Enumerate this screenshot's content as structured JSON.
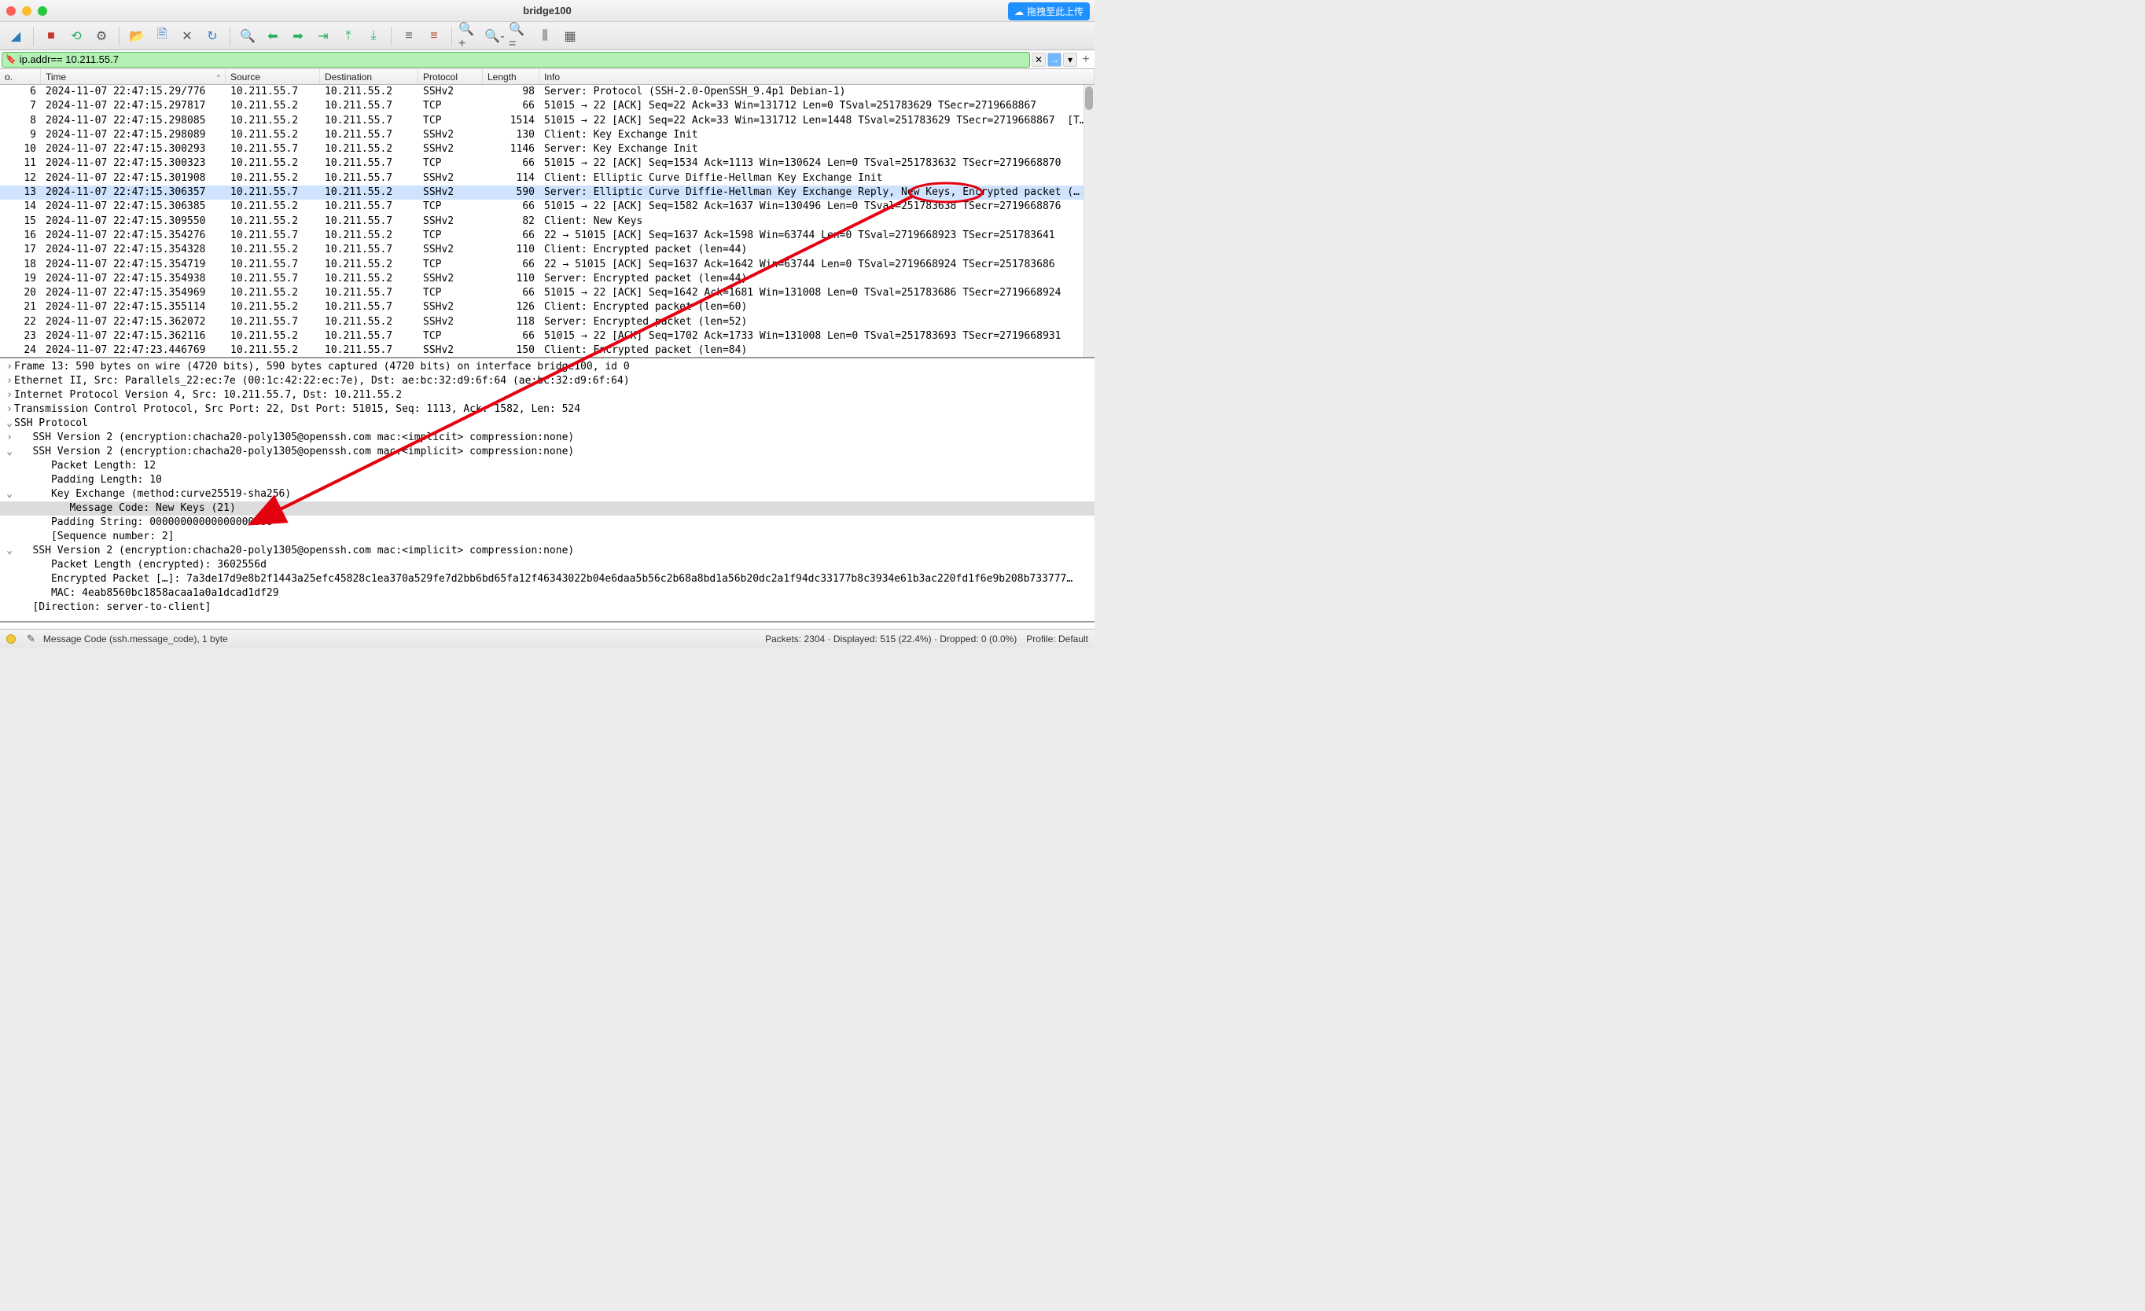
{
  "window": {
    "title": "bridge100"
  },
  "upload": {
    "label": "拖拽至此上传"
  },
  "toolbar": {
    "icons": [
      "shark-fin",
      "stop-capture",
      "restart-capture",
      "options",
      "open-folder",
      "save",
      "close-file",
      "reload",
      "find",
      "go-back",
      "go-forward",
      "jump-target",
      "go-first",
      "go-last",
      "auto-scroll",
      "colorize",
      "zoom-in",
      "zoom-out",
      "zoom-reset",
      "resize-columns",
      "resize-all"
    ]
  },
  "filter": {
    "text": "ip.addr== 10.211.55.7"
  },
  "columns": {
    "no": "o.",
    "time": "Time",
    "source": "Source",
    "destination": "Destination",
    "protocol": "Protocol",
    "length": "Length",
    "info": "Info"
  },
  "packets": [
    {
      "no": 6,
      "time": "2024-11-07 22:47:15.29/776",
      "src": "10.211.55.7",
      "dst": "10.211.55.2",
      "proto": "SSHv2",
      "len": 98,
      "info": "Server: Protocol (SSH-2.0-OpenSSH_9.4p1 Debian-1)"
    },
    {
      "no": 7,
      "time": "2024-11-07 22:47:15.297817",
      "src": "10.211.55.2",
      "dst": "10.211.55.7",
      "proto": "TCP",
      "len": 66,
      "info": "51015 → 22 [ACK] Seq=22 Ack=33 Win=131712 Len=0 TSval=251783629 TSecr=2719668867"
    },
    {
      "no": 8,
      "time": "2024-11-07 22:47:15.298085",
      "src": "10.211.55.2",
      "dst": "10.211.55.7",
      "proto": "TCP",
      "len": 1514,
      "info": "51015 → 22 [ACK] Seq=22 Ack=33 Win=131712 Len=1448 TSval=251783629 TSecr=2719668867  [T…"
    },
    {
      "no": 9,
      "time": "2024-11-07 22:47:15.298089",
      "src": "10.211.55.2",
      "dst": "10.211.55.7",
      "proto": "SSHv2",
      "len": 130,
      "info": "Client: Key Exchange Init"
    },
    {
      "no": 10,
      "time": "2024-11-07 22:47:15.300293",
      "src": "10.211.55.7",
      "dst": "10.211.55.2",
      "proto": "SSHv2",
      "len": 1146,
      "info": "Server: Key Exchange Init"
    },
    {
      "no": 11,
      "time": "2024-11-07 22:47:15.300323",
      "src": "10.211.55.2",
      "dst": "10.211.55.7",
      "proto": "TCP",
      "len": 66,
      "info": "51015 → 22 [ACK] Seq=1534 Ack=1113 Win=130624 Len=0 TSval=251783632 TSecr=2719668870"
    },
    {
      "no": 12,
      "time": "2024-11-07 22:47:15.301908",
      "src": "10.211.55.2",
      "dst": "10.211.55.7",
      "proto": "SSHv2",
      "len": 114,
      "info": "Client: Elliptic Curve Diffie-Hellman Key Exchange Init"
    },
    {
      "no": 13,
      "time": "2024-11-07 22:47:15.306357",
      "src": "10.211.55.7",
      "dst": "10.211.55.2",
      "proto": "SSHv2",
      "len": 590,
      "info": "Server: Elliptic Curve Diffie-Hellman Key Exchange Reply, New Keys, Encrypted packet (…"
    },
    {
      "no": 14,
      "time": "2024-11-07 22:47:15.306385",
      "src": "10.211.55.2",
      "dst": "10.211.55.7",
      "proto": "TCP",
      "len": 66,
      "info": "51015 → 22 [ACK] Seq=1582 Ack=1637 Win=130496 Len=0 TSval=251783638 TSecr=2719668876"
    },
    {
      "no": 15,
      "time": "2024-11-07 22:47:15.309550",
      "src": "10.211.55.2",
      "dst": "10.211.55.7",
      "proto": "SSHv2",
      "len": 82,
      "info": "Client: New Keys"
    },
    {
      "no": 16,
      "time": "2024-11-07 22:47:15.354276",
      "src": "10.211.55.7",
      "dst": "10.211.55.2",
      "proto": "TCP",
      "len": 66,
      "info": "22 → 51015 [ACK] Seq=1637 Ack=1598 Win=63744 Len=0 TSval=2719668923 TSecr=251783641"
    },
    {
      "no": 17,
      "time": "2024-11-07 22:47:15.354328",
      "src": "10.211.55.2",
      "dst": "10.211.55.7",
      "proto": "SSHv2",
      "len": 110,
      "info": "Client: Encrypted packet (len=44)"
    },
    {
      "no": 18,
      "time": "2024-11-07 22:47:15.354719",
      "src": "10.211.55.7",
      "dst": "10.211.55.2",
      "proto": "TCP",
      "len": 66,
      "info": "22 → 51015 [ACK] Seq=1637 Ack=1642 Win=63744 Len=0 TSval=2719668924 TSecr=251783686"
    },
    {
      "no": 19,
      "time": "2024-11-07 22:47:15.354938",
      "src": "10.211.55.7",
      "dst": "10.211.55.2",
      "proto": "SSHv2",
      "len": 110,
      "info": "Server: Encrypted packet (len=44)"
    },
    {
      "no": 20,
      "time": "2024-11-07 22:47:15.354969",
      "src": "10.211.55.2",
      "dst": "10.211.55.7",
      "proto": "TCP",
      "len": 66,
      "info": "51015 → 22 [ACK] Seq=1642 Ack=1681 Win=131008 Len=0 TSval=251783686 TSecr=2719668924"
    },
    {
      "no": 21,
      "time": "2024-11-07 22:47:15.355114",
      "src": "10.211.55.2",
      "dst": "10.211.55.7",
      "proto": "SSHv2",
      "len": 126,
      "info": "Client: Encrypted packet (len=60)"
    },
    {
      "no": 22,
      "time": "2024-11-07 22:47:15.362072",
      "src": "10.211.55.7",
      "dst": "10.211.55.2",
      "proto": "SSHv2",
      "len": 118,
      "info": "Server: Encrypted packet (len=52)"
    },
    {
      "no": 23,
      "time": "2024-11-07 22:47:15.362116",
      "src": "10.211.55.2",
      "dst": "10.211.55.7",
      "proto": "TCP",
      "len": 66,
      "info": "51015 → 22 [ACK] Seq=1702 Ack=1733 Win=131008 Len=0 TSval=251783693 TSecr=2719668931"
    },
    {
      "no": 24,
      "time": "2024-11-07 22:47:23.446769",
      "src": "10.211.55.2",
      "dst": "10.211.55.7",
      "proto": "SSHv2",
      "len": 150,
      "info": "Client: Encrypted packet (len=84)"
    }
  ],
  "selected_packet_no": 13,
  "details": [
    {
      "ind": 0,
      "tw": ">",
      "text": "Frame 13: 590 bytes on wire (4720 bits), 590 bytes captured (4720 bits) on interface bridge100, id 0"
    },
    {
      "ind": 0,
      "tw": ">",
      "text": "Ethernet II, Src: Parallels_22:ec:7e (00:1c:42:22:ec:7e), Dst: ae:bc:32:d9:6f:64 (ae:bc:32:d9:6f:64)"
    },
    {
      "ind": 0,
      "tw": ">",
      "text": "Internet Protocol Version 4, Src: 10.211.55.7, Dst: 10.211.55.2"
    },
    {
      "ind": 0,
      "tw": ">",
      "text": "Transmission Control Protocol, Src Port: 22, Dst Port: 51015, Seq: 1113, Ack: 1582, Len: 524"
    },
    {
      "ind": 0,
      "tw": "v",
      "text": "SSH Protocol"
    },
    {
      "ind": 1,
      "tw": ">",
      "text": "SSH Version 2 (encryption:chacha20-poly1305@openssh.com mac:<implicit> compression:none)"
    },
    {
      "ind": 1,
      "tw": "v",
      "text": "SSH Version 2 (encryption:chacha20-poly1305@openssh.com mac:<implicit> compression:none)"
    },
    {
      "ind": 2,
      "tw": " ",
      "text": "Packet Length: 12"
    },
    {
      "ind": 2,
      "tw": " ",
      "text": "Padding Length: 10"
    },
    {
      "ind": 2,
      "tw": "v",
      "text": "Key Exchange (method:curve25519-sha256)"
    },
    {
      "ind": 3,
      "tw": " ",
      "text": "Message Code: New Keys (21)",
      "sel": true
    },
    {
      "ind": 2,
      "tw": " ",
      "text": "Padding String: 00000000000000000000"
    },
    {
      "ind": 2,
      "tw": " ",
      "text": "[Sequence number: 2]"
    },
    {
      "ind": 1,
      "tw": "v",
      "text": "SSH Version 2 (encryption:chacha20-poly1305@openssh.com mac:<implicit> compression:none)"
    },
    {
      "ind": 2,
      "tw": " ",
      "text": "Packet Length (encrypted): 3602556d"
    },
    {
      "ind": 2,
      "tw": " ",
      "text": "Encrypted Packet […]: 7a3de17d9e8b2f1443a25efc45828c1ea370a529fe7d2bb6bd65fa12f46343022b04e6daa5b56c2b68a8bd1a56b20dc2a1f94dc33177b8c3934e61b3ac220fd1f6e9b208b733777…"
    },
    {
      "ind": 2,
      "tw": " ",
      "text": "MAC: 4eab8560bc1858acaa1a0a1dcad1df29"
    },
    {
      "ind": 1,
      "tw": " ",
      "text": "[Direction: server-to-client]"
    }
  ],
  "status": {
    "left": "Message Code (ssh.message_code), 1 byte",
    "mid": "Packets: 2304 · Displayed: 515 (22.4%) · Dropped: 0 (0.0%)",
    "right": "Profile: Default"
  }
}
